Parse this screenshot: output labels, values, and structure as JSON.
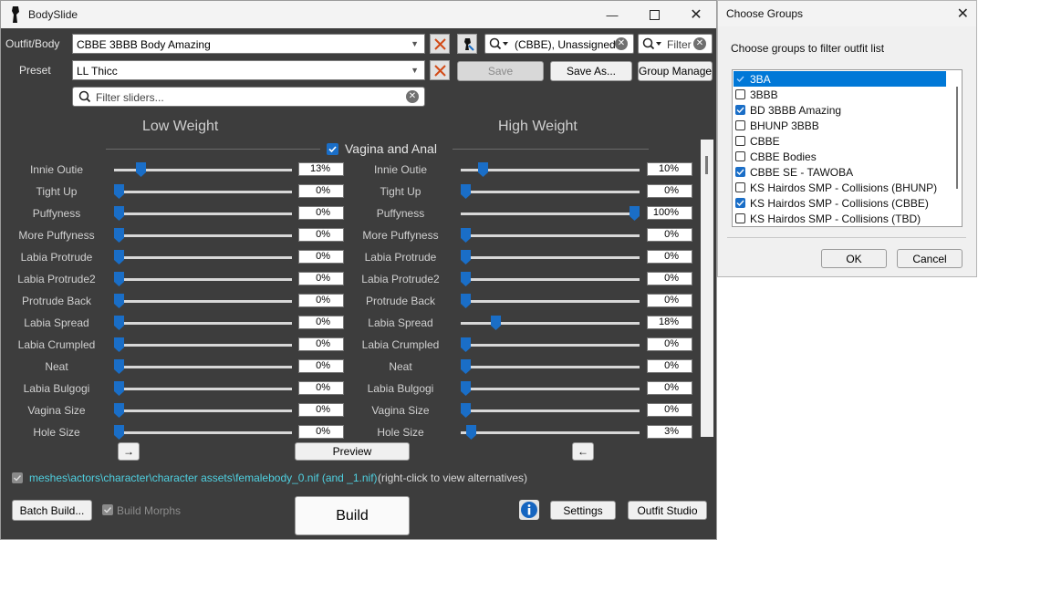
{
  "bodyslide": {
    "title": "BodySlide",
    "labels": {
      "outfit_body": "Outfit/Body",
      "preset": "Preset"
    },
    "outfit_value": "CBBE 3BBB Body Amazing",
    "preset_value": "LL Thicc",
    "group_filter_value": "(CBBE), Unassigned",
    "outfit_filter_placeholder": "Filter",
    "slider_filter_placeholder": "Filter sliders...",
    "buttons": {
      "save": "Save",
      "save_as": "Save As...",
      "group_manager": "Group Manager",
      "preview": "Preview",
      "batch_build": "Batch Build...",
      "build": "Build",
      "settings": "Settings",
      "outfit_studio": "Outfit Studio",
      "arrow_right": "→",
      "arrow_left": "←"
    },
    "columns": {
      "low": "Low Weight",
      "high": "High Weight"
    },
    "category": "Vagina and Anal",
    "sliders": [
      {
        "name": "Innie Outie",
        "low": 13,
        "high": 10
      },
      {
        "name": "Tight Up",
        "low": 0,
        "high": 0
      },
      {
        "name": "Puffyness",
        "low": 0,
        "high": 100
      },
      {
        "name": "More Puffyness",
        "low": 0,
        "high": 0
      },
      {
        "name": "Labia Protrude",
        "low": 0,
        "high": 0
      },
      {
        "name": "Labia Protrude2",
        "low": 0,
        "high": 0
      },
      {
        "name": "Protrude Back",
        "low": 0,
        "high": 0
      },
      {
        "name": "Labia Spread",
        "low": 0,
        "high": 18
      },
      {
        "name": "Labia Crumpled",
        "low": 0,
        "high": 0
      },
      {
        "name": "Neat",
        "low": 0,
        "high": 0
      },
      {
        "name": "Labia Bulgogi",
        "low": 0,
        "high": 0
      },
      {
        "name": "Vagina Size",
        "low": 0,
        "high": 0
      },
      {
        "name": "Hole Size",
        "low": 0,
        "high": 3
      }
    ],
    "output_path": "meshes\\actors\\character\\character assets\\femalebody_0.nif (and _1.nif)",
    "output_hint": "(right-click to view alternatives)",
    "build_morphs": "Build Morphs",
    "colors": {
      "accent": "#1a6ec7",
      "path": "#4fd0e0",
      "panel": "#3d3d3d"
    }
  },
  "groups_dialog": {
    "title": "Choose Groups",
    "prompt": "Choose groups to filter outfit list",
    "items": [
      {
        "label": "3BA",
        "checked": true,
        "selected": true
      },
      {
        "label": "3BBB",
        "checked": false,
        "selected": false
      },
      {
        "label": "BD 3BBB Amazing",
        "checked": true,
        "selected": false
      },
      {
        "label": "BHUNP 3BBB",
        "checked": false,
        "selected": false
      },
      {
        "label": "CBBE",
        "checked": false,
        "selected": false
      },
      {
        "label": "CBBE Bodies",
        "checked": false,
        "selected": false
      },
      {
        "label": "CBBE SE - TAWOBA",
        "checked": true,
        "selected": false
      },
      {
        "label": "KS Hairdos SMP - Collisions (BHUNP)",
        "checked": false,
        "selected": false
      },
      {
        "label": "KS Hairdos SMP - Collisions (CBBE)",
        "checked": true,
        "selected": false
      },
      {
        "label": "KS Hairdos SMP - Collisions (TBD)",
        "checked": false,
        "selected": false
      }
    ],
    "ok": "OK",
    "cancel": "Cancel"
  }
}
